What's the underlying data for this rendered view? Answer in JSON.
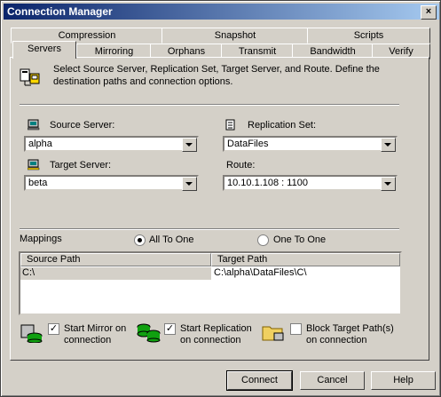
{
  "window": {
    "title": "Connection Manager",
    "close": "×"
  },
  "tabs_back": [
    "Compression",
    "Snapshot",
    "Scripts"
  ],
  "tabs_front": [
    "Servers",
    "Mirroring",
    "Orphans",
    "Transmit",
    "Bandwidth",
    "Verify"
  ],
  "description": "Select Source Server, Replication Set, Target Server, and Route.  Define the destination paths and connection options.",
  "source_server": {
    "label": "Source Server:",
    "value": "alpha"
  },
  "replication_set": {
    "label": "Replication Set:",
    "value": "DataFiles"
  },
  "target_server": {
    "label": "Target Server:",
    "value": "beta"
  },
  "route": {
    "label": "Route:",
    "value": "10.10.1.108 : 1100"
  },
  "mappings": {
    "label": "Mappings",
    "radio_all": "All To One",
    "radio_one": "One To One",
    "columns": [
      "Source Path",
      "Target Path"
    ],
    "rows": [
      {
        "source": "C:\\",
        "target": "C:\\alpha\\DataFiles\\C\\"
      }
    ]
  },
  "options": {
    "start_mirror": {
      "line1": "Start Mirror on",
      "line2": "connection",
      "checked": true
    },
    "start_replication": {
      "line1": "Start Replication",
      "line2": "on connection",
      "checked": true
    },
    "block_target": {
      "line1": "Block Target Path(s)",
      "line2": "on connection",
      "checked": false
    }
  },
  "buttons": {
    "connect": "Connect",
    "cancel": "Cancel",
    "help": "Help"
  }
}
